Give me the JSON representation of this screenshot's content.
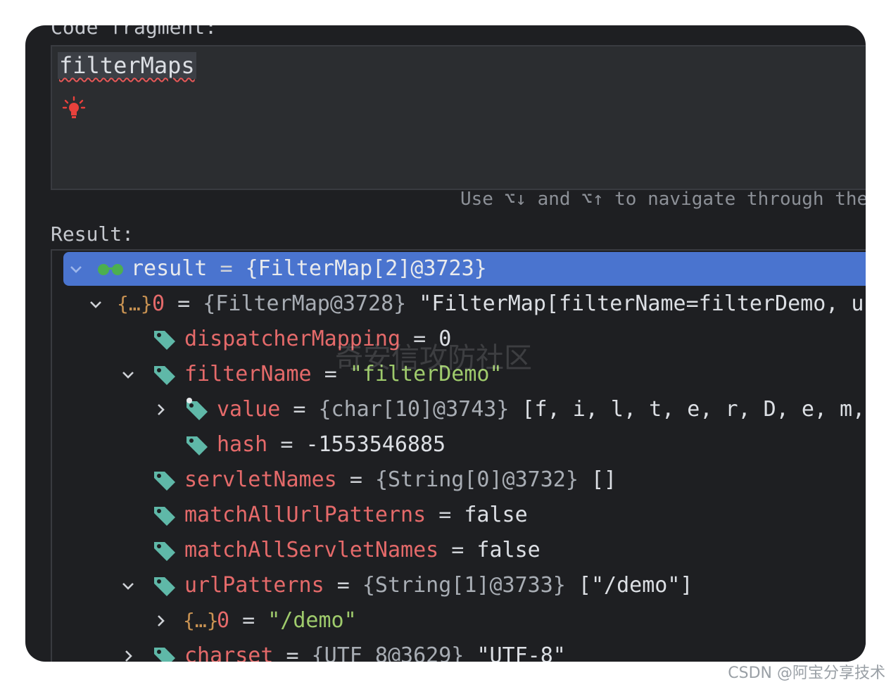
{
  "top_label": "Code fragment:",
  "editor": {
    "code": "filterMaps"
  },
  "hint": "Use ⌥↓ and ⌥↑ to navigate through the",
  "result_label": "Result:",
  "rows": [
    {
      "name": "result",
      "eq": "=",
      "ref": "{FilterMap[2]@3723}",
      "value": ""
    },
    {
      "name": "0",
      "eq": "=",
      "ref": "{FilterMap@3728}",
      "value": "\"FilterMap[filterName=filterDemo, url"
    },
    {
      "name": "dispatcherMapping",
      "eq": "=",
      "ref": "",
      "value": "0"
    },
    {
      "name": "filterName",
      "eq": "=",
      "ref": "",
      "value": "\"filterDemo\""
    },
    {
      "name": "value",
      "eq": "=",
      "ref": "{char[10]@3743}",
      "value": "[f, i, l, t, e, r, D, e, m,"
    },
    {
      "name": "hash",
      "eq": "=",
      "ref": "",
      "value": "-1553546885"
    },
    {
      "name": "servletNames",
      "eq": "=",
      "ref": "{String[0]@3732}",
      "value": "[]"
    },
    {
      "name": "matchAllUrlPatterns",
      "eq": "=",
      "ref": "",
      "value": "false"
    },
    {
      "name": "matchAllServletNames",
      "eq": "=",
      "ref": "",
      "value": "false"
    },
    {
      "name": "urlPatterns",
      "eq": "=",
      "ref": "{String[1]@3733}",
      "value": "[\"/demo\"]"
    },
    {
      "name": "0",
      "eq": "=",
      "ref": "",
      "value": "\"/demo\""
    },
    {
      "name": "charset",
      "eq": "=",
      "ref": "{UTF_8@3629}",
      "value": "\"UTF-8\""
    }
  ],
  "obj_icon": "{…}",
  "watermark": "奇安信攻防社区",
  "credit": "CSDN @阿宝分享技术",
  "colors": {
    "background": "#1e1f22",
    "selection": "#4a74cf",
    "field_name": "#e56a6a",
    "string": "#9fcb6c",
    "tag_icon": "#5fb8a8"
  }
}
